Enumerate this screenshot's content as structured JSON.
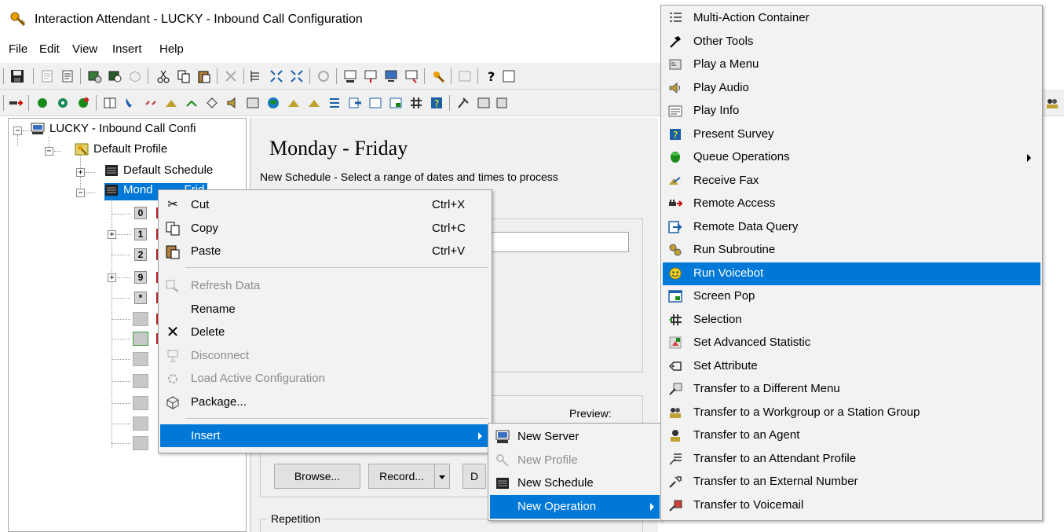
{
  "window": {
    "title": "Interaction Attendant - LUCKY - Inbound Call Configuration"
  },
  "menubar": [
    "File",
    "Edit",
    "View",
    "Insert",
    "Help"
  ],
  "tree": {
    "root": "LUCKY - Inbound Call Confi",
    "profile": "Default Profile",
    "schedule1": "Default Schedule",
    "schedule2": "Mond",
    "schedule2_tail": "Frid",
    "num_keys": [
      "0",
      "1",
      "2",
      "9",
      "*"
    ]
  },
  "content": {
    "heading": "Monday - Friday",
    "subtitle": "New Schedule - Select a range of dates and times to process",
    "preview_label": "Preview:",
    "browse_button": "Browse...",
    "record_button": "Record...",
    "partial_button": "D",
    "repetition_label": "Repetition"
  },
  "context_menu": {
    "items": [
      {
        "label": "Cut",
        "shortcut": "Ctrl+X",
        "icon": "scissors-icon"
      },
      {
        "label": "Copy",
        "shortcut": "Ctrl+C",
        "icon": "copy-icon"
      },
      {
        "label": "Paste",
        "shortcut": "Ctrl+V",
        "icon": "paste-icon"
      },
      {
        "label": "Refresh Data",
        "shortcut": "",
        "icon": "refresh-data-icon",
        "disabled": true
      },
      {
        "label": "Rename",
        "shortcut": "",
        "icon": ""
      },
      {
        "label": "Delete",
        "shortcut": "",
        "icon": "delete-icon"
      },
      {
        "label": "Disconnect",
        "shortcut": "",
        "icon": "disconnect-icon",
        "disabled": true
      },
      {
        "label": "Load Active Configuration",
        "shortcut": "",
        "icon": "load-config-icon",
        "disabled": true
      },
      {
        "label": "Package...",
        "shortcut": "",
        "icon": "package-icon"
      },
      {
        "label": "Insert",
        "shortcut": "",
        "icon": "",
        "selected": true
      }
    ]
  },
  "insert_submenu": {
    "items": [
      {
        "label": "New Server",
        "icon": "server-icon"
      },
      {
        "label": "New Profile",
        "icon": "profile-icon",
        "disabled": true
      },
      {
        "label": "New Schedule",
        "icon": "schedule-icon"
      },
      {
        "label": "New Operation",
        "icon": "",
        "selected": true
      }
    ]
  },
  "operation_submenu": {
    "items": [
      {
        "label": "Multi-Action Container",
        "icon": "multi-action-icon"
      },
      {
        "label": "Other Tools",
        "icon": "hammer-icon"
      },
      {
        "label": "Play a Menu",
        "icon": "play-menu-icon"
      },
      {
        "label": "Play Audio",
        "icon": "speaker-icon"
      },
      {
        "label": "Play Info",
        "icon": "play-info-icon"
      },
      {
        "label": "Present Survey",
        "icon": "survey-icon"
      },
      {
        "label": "Queue Operations",
        "icon": "queue-icon",
        "submenu": true
      },
      {
        "label": "Receive Fax",
        "icon": "fax-icon"
      },
      {
        "label": "Remote Access",
        "icon": "remote-access-icon"
      },
      {
        "label": "Remote Data Query",
        "icon": "remote-query-icon"
      },
      {
        "label": "Run Subroutine",
        "icon": "subroutine-icon"
      },
      {
        "label": "Run Voicebot",
        "icon": "voicebot-icon",
        "selected": true
      },
      {
        "label": "Screen Pop",
        "icon": "screen-pop-icon"
      },
      {
        "label": "Selection",
        "icon": "selection-icon"
      },
      {
        "label": "Set Advanced Statistic",
        "icon": "statistic-icon"
      },
      {
        "label": "Set Attribute",
        "icon": "attribute-icon"
      },
      {
        "label": "Transfer to a Different Menu",
        "icon": "transfer-menu-icon"
      },
      {
        "label": "Transfer to a Workgroup or a Station Group",
        "icon": "transfer-workgroup-icon"
      },
      {
        "label": "Transfer to an Agent",
        "icon": "transfer-agent-icon"
      },
      {
        "label": "Transfer to an Attendant Profile",
        "icon": "transfer-profile-icon"
      },
      {
        "label": "Transfer to an External Number",
        "icon": "transfer-external-icon"
      },
      {
        "label": "Transfer to Voicemail",
        "icon": "transfer-voicemail-icon"
      }
    ]
  },
  "colors": {
    "selection": "#0078d7",
    "menu_bg": "#f2f2f2",
    "disabled_text": "#8d8d8d"
  }
}
